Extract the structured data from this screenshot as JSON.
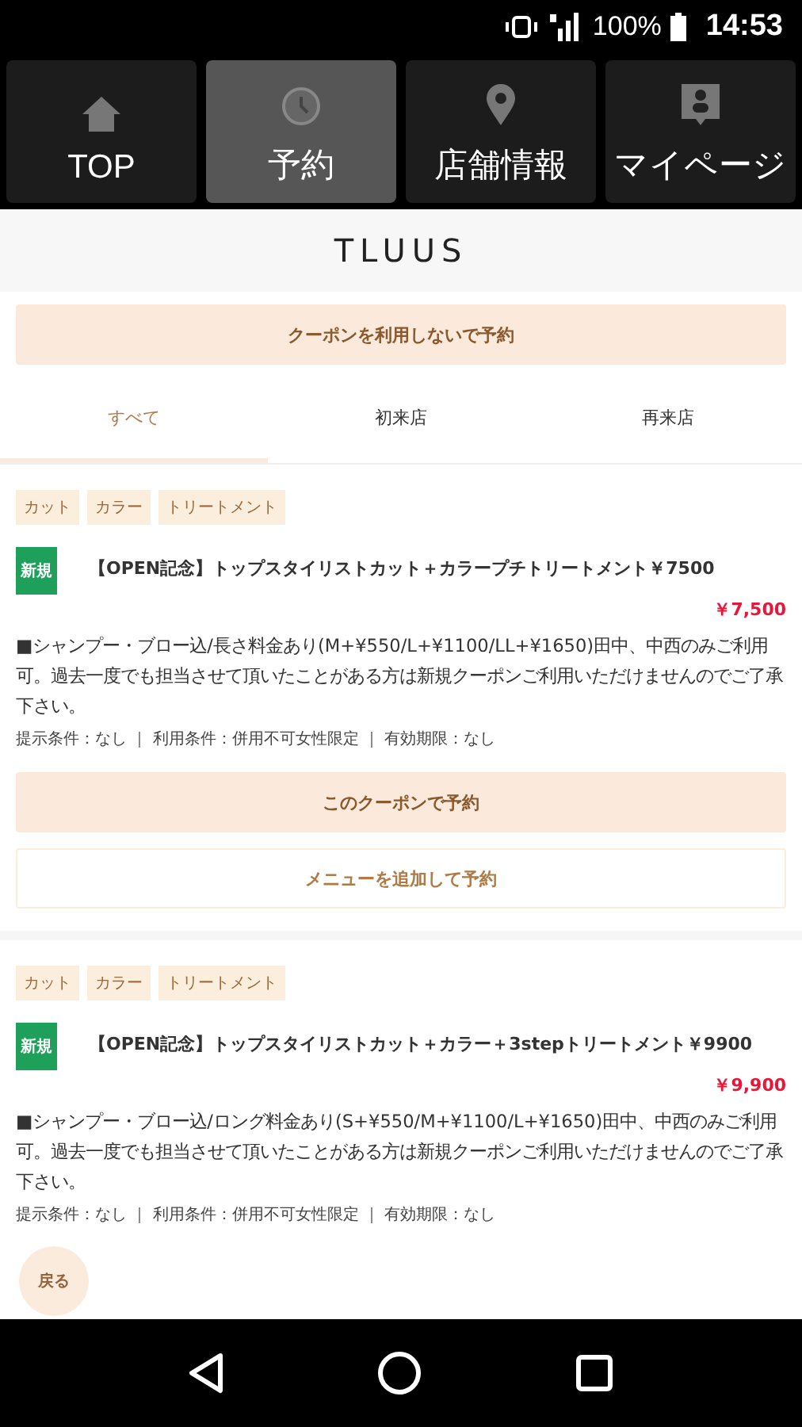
{
  "status_bar": {
    "battery": "100%",
    "time": "14:53"
  },
  "nav": [
    {
      "label": "TOP",
      "selected": false
    },
    {
      "label": "予約",
      "selected": true
    },
    {
      "label": "店舗情報",
      "selected": false
    },
    {
      "label": "マイページ",
      "selected": false
    }
  ],
  "shop_name": "TLUUS",
  "book_without_coupon": "クーポンを利用しないで予約",
  "tabs": [
    {
      "label": "すべて",
      "selected": true
    },
    {
      "label": "初来店",
      "selected": false
    },
    {
      "label": "再来店",
      "selected": false
    }
  ],
  "coupons": [
    {
      "tags": [
        "カット",
        "カラー",
        "トリートメント"
      ],
      "badge": "新規",
      "title": "【OPEN記念】トップスタイリストカット＋カラープチトリートメント￥7500",
      "price": "￥7,500",
      "description": "■シャンプー・ブロー込/長さ料金あり(M+¥550/L+¥1100/LL+¥1650)田中、中西のみご利用可。過去一度でも担当させて頂いたことがある方は新規クーポンご利用いただけませんのでご了承下さい。",
      "conditions": "提示条件：なし ｜ 利用条件：併用不可女性限定 ｜ 有効期限：なし",
      "buttons": [
        {
          "label": "このクーポンで予約",
          "kind": "filled"
        },
        {
          "label": "メニューを追加して予約",
          "kind": "outline"
        }
      ]
    },
    {
      "tags": [
        "カット",
        "カラー",
        "トリートメント"
      ],
      "badge": "新規",
      "title": "【OPEN記念】トップスタイリストカット＋カラー＋3stepトリートメント￥9900",
      "price": "￥9,900",
      "description": "■シャンプー・ブロー込/ロング料金あり(S+¥550/M+¥1100/L+¥1650)田中、中西のみご利用可。過去一度でも担当させて頂いたことがある方は新規クーポンご利用いただけませんのでご了承下さい。",
      "conditions": "提示条件：なし ｜ 利用条件：併用不可女性限定 ｜ 有効期限：なし"
    }
  ],
  "back_button": "戻る"
}
